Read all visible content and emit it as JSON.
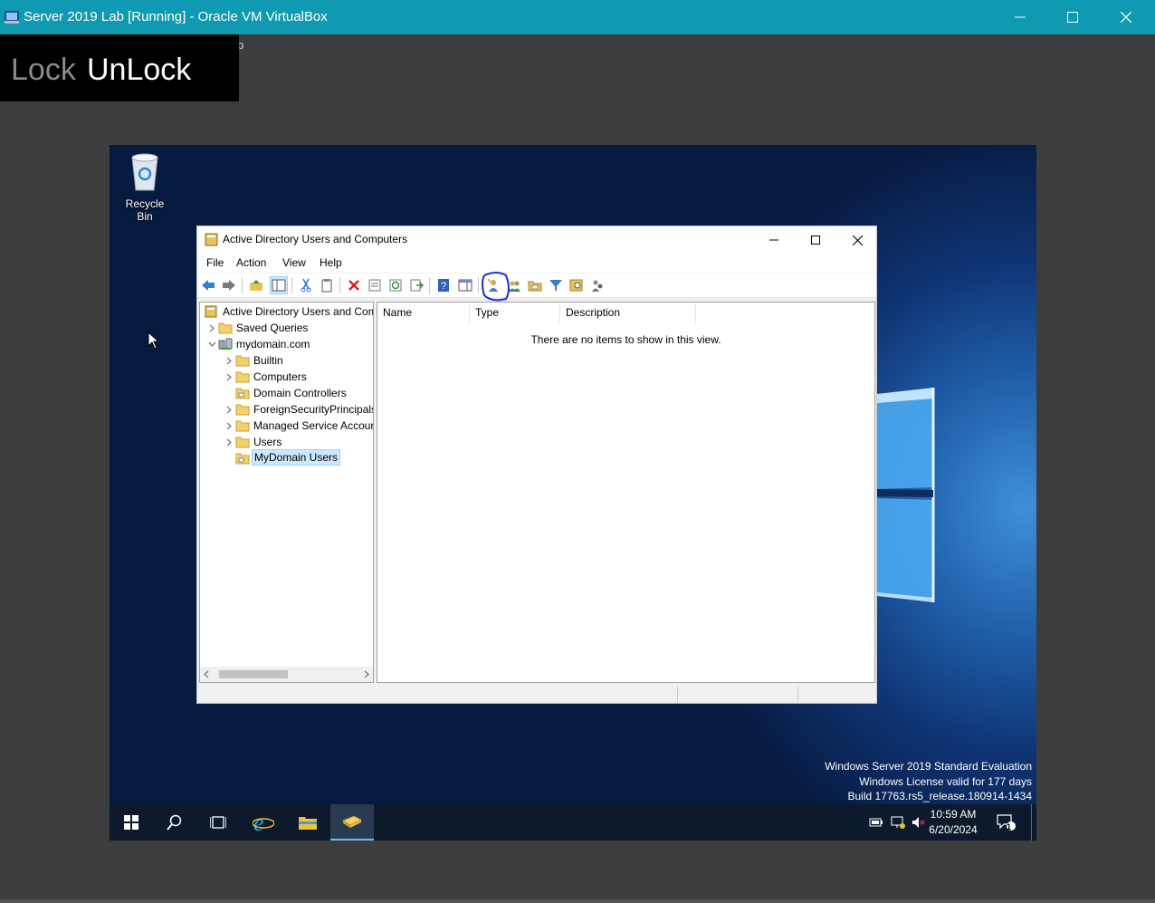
{
  "host": {
    "title": "Server 2019 Lab [Running] - Oracle VM VirtualBox",
    "menu_stub": "p",
    "controls": [
      "minimize-icon",
      "maximize-icon",
      "close-icon"
    ]
  },
  "lock_panel": {
    "lock_label": "Lock",
    "unlock_label": "UnLock"
  },
  "desktop": {
    "recycle_bin_label": "Recycle Bin",
    "watermark": {
      "line1": "Windows Server 2019 Standard Evaluation",
      "line2": "Windows License valid for 177 days",
      "line3": "Build 17763.rs5_release.180914-1434"
    }
  },
  "taskbar": {
    "items": [
      "start-icon",
      "search-icon",
      "task-view-icon",
      "internet-explorer-icon",
      "file-explorer-icon",
      "server-manager-icon"
    ],
    "tray_icons": [
      "power-icon",
      "network-icon",
      "volume-muted-icon"
    ],
    "clock_time": "10:59 AM",
    "clock_date": "6/20/2024",
    "notification_count": "1"
  },
  "aduc": {
    "title": "Active Directory Users and Computers",
    "menu": {
      "file": "File",
      "action": "Action",
      "view": "View",
      "help": "Help"
    },
    "toolbar_icons": [
      "back-icon",
      "forward-icon",
      "up-level-icon",
      "show-tree-icon",
      "cut-icon",
      "copy-icon",
      "delete-icon",
      "properties-icon",
      "refresh-icon",
      "export-list-icon",
      "help-icon",
      "show-action-pane-icon",
      "create-user-icon",
      "create-group-icon",
      "create-ou-icon",
      "filter-icon",
      "find-icon",
      "add-to-group-icon"
    ],
    "highlighted_toolbar_icon": "create-user-icon",
    "tree": {
      "root": "Active Directory Users and Com",
      "saved_queries": "Saved Queries",
      "domain": "mydomain.com",
      "children": [
        {
          "label": "Builtin",
          "expandable": true
        },
        {
          "label": "Computers",
          "expandable": true
        },
        {
          "label": "Domain Controllers",
          "expandable": false
        },
        {
          "label": "ForeignSecurityPrincipals",
          "expandable": true
        },
        {
          "label": "Managed Service Accour",
          "expandable": true
        },
        {
          "label": "Users",
          "expandable": true
        },
        {
          "label": "MyDomain Users",
          "expandable": false,
          "selected": true
        }
      ]
    },
    "list": {
      "columns": {
        "name": "Name",
        "type": "Type",
        "description": "Description"
      },
      "empty_message": "There are no items to show in this view."
    },
    "colors": {
      "selection": "#cce8ff",
      "annotation_circle": "#1a2fd6"
    }
  }
}
